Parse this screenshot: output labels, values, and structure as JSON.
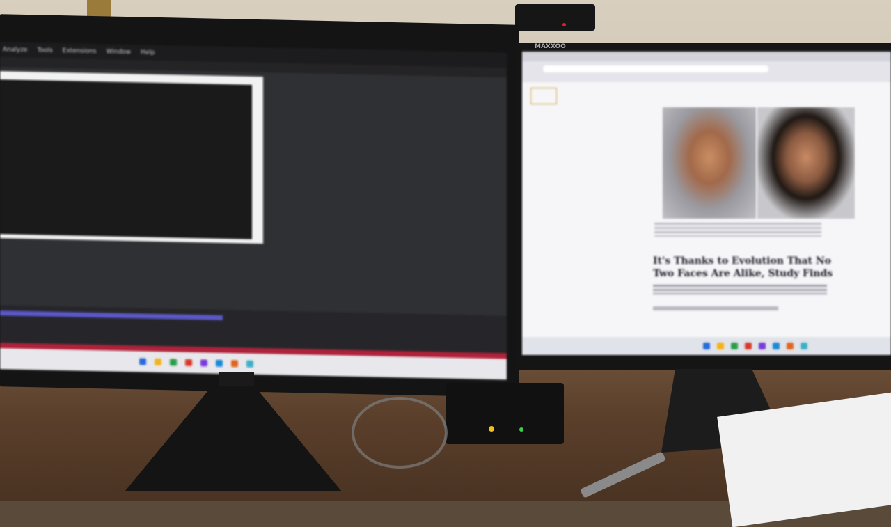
{
  "left_monitor": {
    "menu_items": [
      "Analyze",
      "Tools",
      "Extensions",
      "Window",
      "Help"
    ],
    "taskbar_icon_colors": [
      "#2a6bd8",
      "#f2b31c",
      "#2a9d4a",
      "#d83a2a",
      "#7b3ad8",
      "#1a8ad8",
      "#e0661f",
      "#3ab0c8"
    ]
  },
  "right_monitor": {
    "brand": "MAXXOO",
    "article": {
      "headline": "It's Thanks to Evolution That No Two Faces Are Alike, Study Finds"
    }
  },
  "colors": {
    "timeline_accent": "#5b58c9",
    "status_bar_red": "#b0213a"
  }
}
